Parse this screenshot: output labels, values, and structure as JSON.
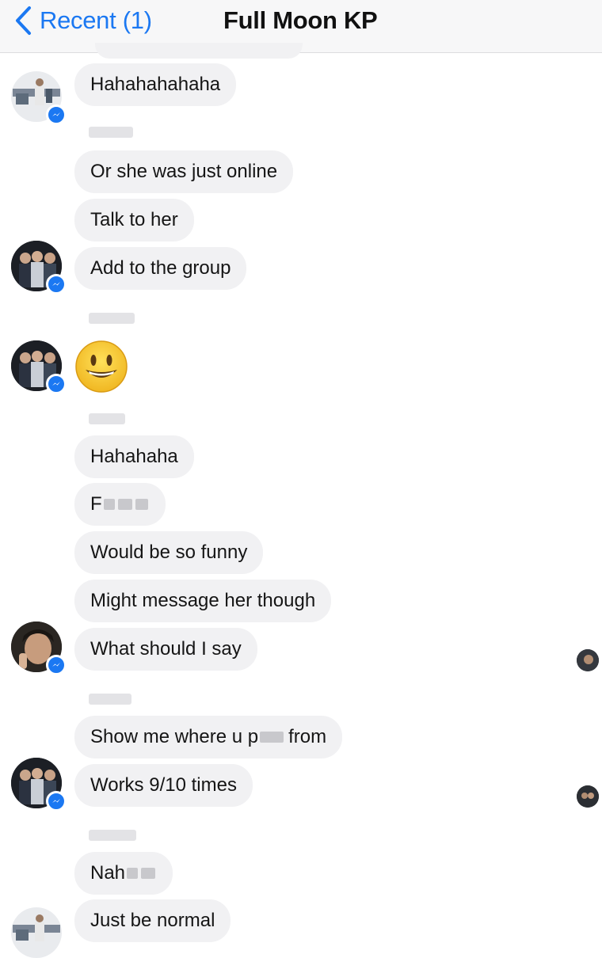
{
  "header": {
    "back_label": "Recent (1)",
    "title": "Full Moon KP"
  },
  "messages": [
    {
      "text": "Hahahahahaha"
    },
    {
      "text": "Or she was just online"
    },
    {
      "text": "Talk to her"
    },
    {
      "text": "Add to the group"
    },
    {
      "emoji": "grinning-face"
    },
    {
      "text": "Hahahaha"
    },
    {
      "text": "F"
    },
    {
      "text": "Would be so funny"
    },
    {
      "text": "Might message her though"
    },
    {
      "text": "What should I say"
    },
    {
      "text_a": "Show me where u p",
      "text_b": "from"
    },
    {
      "text": "Works 9/10 times"
    },
    {
      "text": "Nah"
    },
    {
      "text": "Just be normal"
    }
  ],
  "colors": {
    "accent": "#1b78f2",
    "bubble": "#f1f1f3",
    "header_bg": "#f7f7f8"
  },
  "icons": {
    "back": "chevron-left-icon",
    "badge": "messenger-icon",
    "emoji": "smiley-emoji-icon"
  }
}
